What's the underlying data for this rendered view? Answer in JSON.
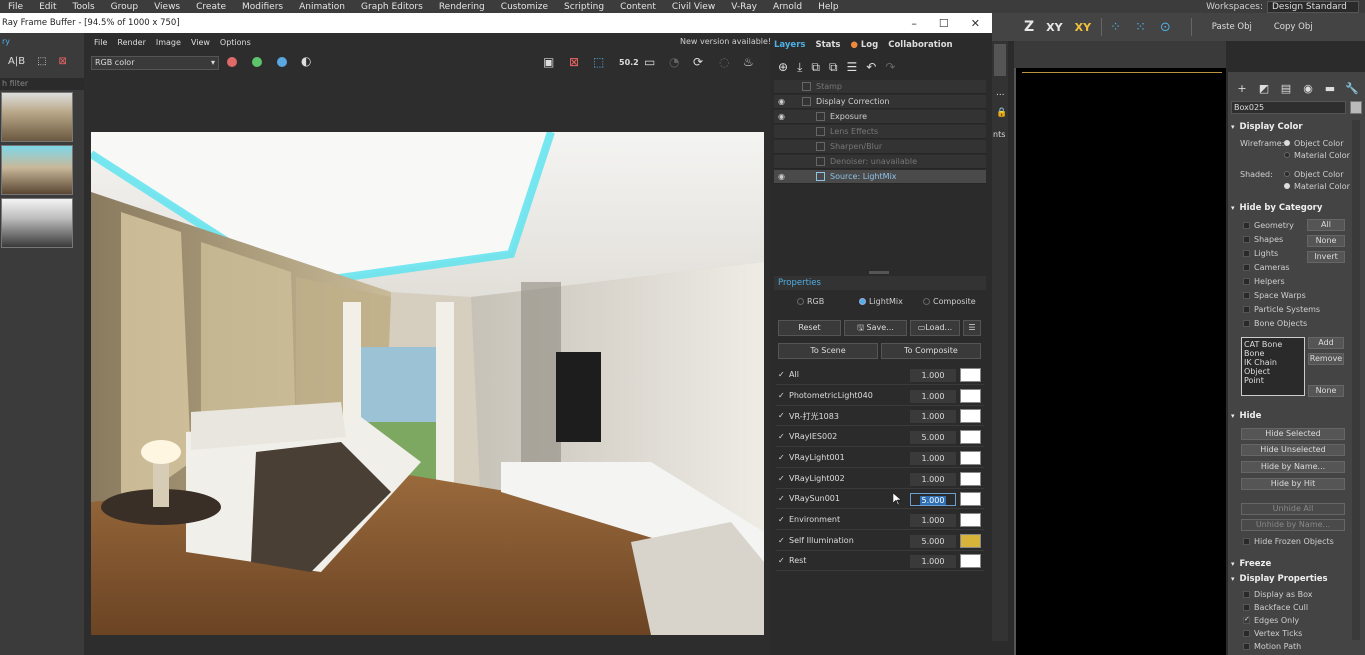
{
  "menubar": {
    "items": [
      "File",
      "Edit",
      "Tools",
      "Group",
      "Views",
      "Create",
      "Modifiers",
      "Animation",
      "Graph Editors",
      "Rendering",
      "Customize",
      "Scripting",
      "Content",
      "Civil View",
      "V-Ray",
      "Arnold",
      "Help"
    ],
    "workspaces_label": "Workspaces:",
    "workspaces_value": "Design Standard"
  },
  "maxtoolbar": {
    "z": "Z",
    "xy": "XY",
    "xy2": "XY",
    "paste": "Paste Obj",
    "copy": "Copy Obj"
  },
  "vfb": {
    "title": "Ray Frame Buffer - [94.5% of 1000 x 750]",
    "left_label": "ry",
    "filter_placeholder": "h filter",
    "menu": [
      "File",
      "Render",
      "Image",
      "View",
      "Options"
    ],
    "new_version": "New version available!",
    "channel": "RGB color",
    "dot_colors": [
      "#e06a6a",
      "#5ec46b",
      "#5aa8e0"
    ],
    "tb_zoom": "50.2",
    "tabs": {
      "layers": "Layers",
      "stats": "Stats",
      "log": "Log",
      "collab": "Collaboration"
    },
    "layers": [
      {
        "label": "Stamp"
      },
      {
        "label": "Display Correction"
      },
      {
        "label": "Exposure"
      },
      {
        "label": "Lens Effects"
      },
      {
        "label": "Sharpen/Blur"
      },
      {
        "label": "Denoiser: unavailable"
      },
      {
        "label": "Source: LightMix"
      }
    ],
    "properties": "Properties",
    "modes": {
      "rgb": "RGB",
      "lightmix": "LightMix",
      "composite": "Composite"
    },
    "buttons": {
      "reset": "Reset",
      "save": "Save...",
      "load": "Load...",
      "to_scene": "To Scene",
      "to_composite": "To Composite"
    },
    "lightmix": [
      {
        "name": "All",
        "value": "1.000",
        "color": "#ffffff"
      },
      {
        "name": "PhotometricLight040",
        "value": "1.000",
        "color": "#ffffff"
      },
      {
        "name": "VR-打光1083",
        "value": "1.000",
        "color": "#ffffff"
      },
      {
        "name": "VRayIES002",
        "value": "5.000",
        "color": "#ffffff"
      },
      {
        "name": "VRayLight001",
        "value": "1.000",
        "color": "#ffffff"
      },
      {
        "name": "VRayLight002",
        "value": "1.000",
        "color": "#ffffff"
      },
      {
        "name": "VRaySun001",
        "value": "5.000",
        "color": "#ffffff"
      },
      {
        "name": "Environment",
        "value": "1.000",
        "color": "#ffffff"
      },
      {
        "name": "Self Illumination",
        "value": "5.000",
        "color": "#d9b43a"
      },
      {
        "name": "Rest",
        "value": "1.000",
        "color": "#ffffff"
      }
    ],
    "side_fragment": "nts",
    "side_dots": "..."
  },
  "cmdpanel": {
    "object_name": "Box025",
    "display_color": "Display Color",
    "wireframe": "Wireframe:",
    "shaded": "Shaded:",
    "object_color": "Object Color",
    "material_color": "Material Color",
    "hide_by_category": "Hide by Category",
    "categories": [
      "Geometry",
      "Shapes",
      "Lights",
      "Cameras",
      "Helpers",
      "Space Warps",
      "Particle Systems",
      "Bone Objects"
    ],
    "cat_btns": {
      "all": "All",
      "none": "None",
      "invert": "Invert"
    },
    "cat_list": [
      "CAT Bone",
      "Bone",
      "IK Chain Object",
      "Point"
    ],
    "list_btns": {
      "add": "Add",
      "remove": "Remove",
      "none": "None"
    },
    "hide": "Hide",
    "hide_btns": [
      "Hide Selected",
      "Hide Unselected",
      "Hide by Name...",
      "Hide by Hit"
    ],
    "unhide_btns": [
      "Unhide All",
      "Unhide by Name..."
    ],
    "hide_frozen": "Hide Frozen Objects",
    "freeze": "Freeze",
    "display_props": "Display Properties",
    "display_items": [
      "Display as Box",
      "Backface Cull",
      "Edges Only",
      "Vertex Ticks",
      "Motion Path"
    ]
  }
}
